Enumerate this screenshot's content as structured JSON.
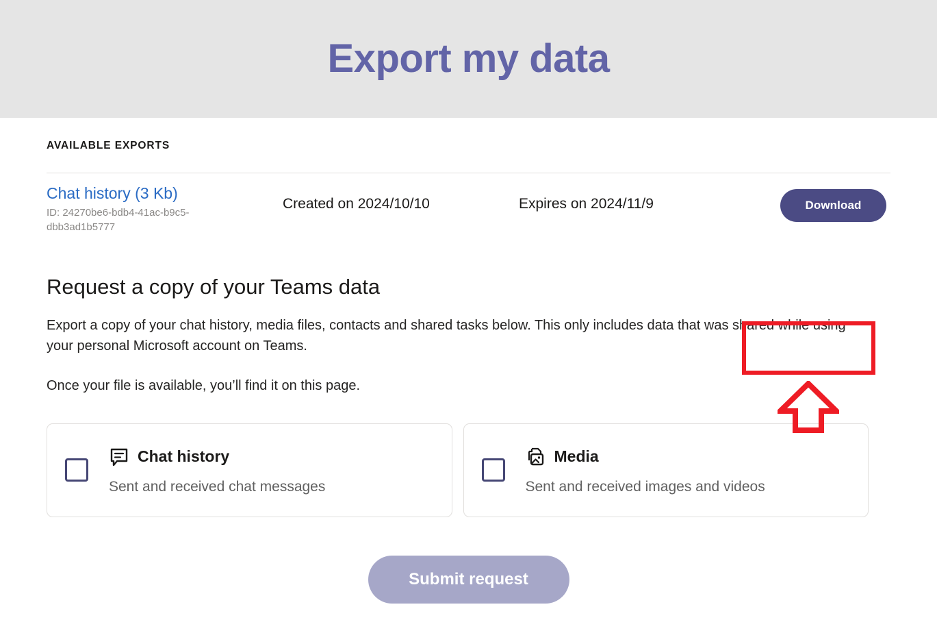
{
  "header": {
    "title": "Export my data",
    "title_color": "#6264a7",
    "band_color": "#e5e5e5"
  },
  "available_exports": {
    "section_label": "AVAILABLE EXPORTS",
    "rows": [
      {
        "file_name": "Chat history (3 Kb)",
        "file_id": "ID: 24270be6-bdb4-41ac-b9c5-dbb3ad1b5777",
        "created": "Created on 2024/10/10",
        "expires": "Expires on 2024/11/9",
        "download_label": "Download"
      }
    ]
  },
  "annotation": {
    "highlight_color": "#ee1c25",
    "box_target": "download-button",
    "arrow_direction": "up"
  },
  "request": {
    "heading": "Request a copy of your Teams data",
    "paragraph_1": "Export a copy of your chat history, media files, contacts and shared tasks below. This only includes data that was shared while using your personal Microsoft account on Teams.",
    "paragraph_2": "Once your file is available, you’ll find it on this page.",
    "options": [
      {
        "title": "Chat history",
        "subtitle": "Sent and received chat messages",
        "icon": "chat-bubble-icon",
        "checked": false
      },
      {
        "title": "Media",
        "subtitle": "Sent and received images and videos",
        "icon": "media-images-icon",
        "checked": false
      }
    ],
    "submit_label": "Submit request",
    "submit_color": "#a6a7c8"
  },
  "colors": {
    "link_blue": "#2a6bc4",
    "download_purple": "#4b4b84",
    "checkbox_border": "#464775",
    "muted_gray": "#8a8886"
  }
}
